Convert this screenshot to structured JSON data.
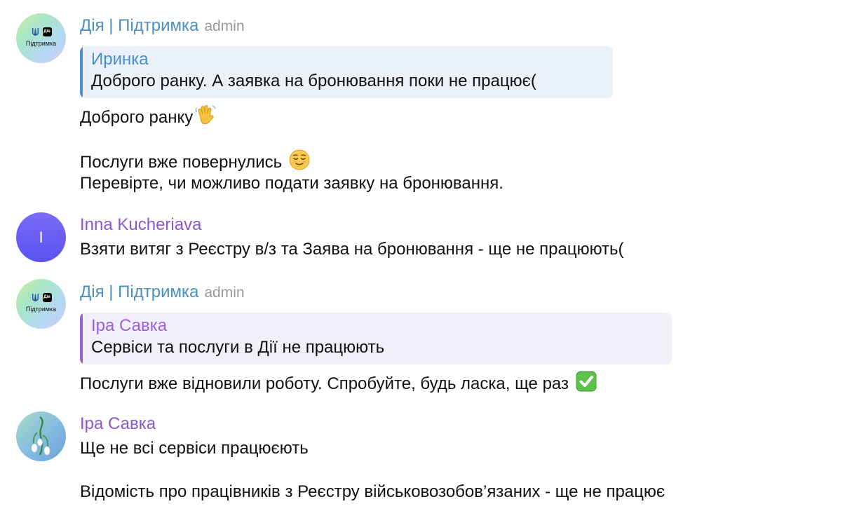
{
  "messages": [
    {
      "sender": "Дія | Підтримка",
      "tag": "admin",
      "avatar_label": "Підтримка",
      "avatar_badge": "Дія",
      "reply": {
        "name": "Иринка",
        "text": "Доброго ранку. А заявка на бронювання поки не працює("
      },
      "lines": [
        "Доброго ранку",
        "Послуги вже повернулись",
        "Перевірте, чи можливо подати заявку на бронювання."
      ],
      "emoji": [
        "waving-hand",
        "relieved-face"
      ]
    },
    {
      "sender": "Inna Kucheriava",
      "avatar_initial": "I",
      "lines": [
        "Взяти витяг з Реєстру в/з та Заява на бронювання - ще не працюють("
      ]
    },
    {
      "sender": "Дія | Підтримка",
      "tag": "admin",
      "avatar_label": "Підтримка",
      "avatar_badge": "Дія",
      "reply": {
        "name": "Іра Савка",
        "text": "Сервіси та послуги в Дії не працюють"
      },
      "lines": [
        "Послуги вже відновили роботу. Спробуйте, будь ласка, ще раз"
      ],
      "emoji": [
        "check-mark-button"
      ]
    },
    {
      "sender": "Іра Савка",
      "lines": [
        "Ще не всі сервіси працюєють",
        "Відомість про працівників з Реєстру військовозобов’язаних - ще не працює"
      ]
    }
  ],
  "colors": {
    "diia_name": "#4a8fc0",
    "purple_name": "#8a58d0",
    "admin_tag": "#9a9a9a",
    "reply_blue_bar": "#4a8fd8",
    "reply_purple_bar": "#9a62d8"
  }
}
